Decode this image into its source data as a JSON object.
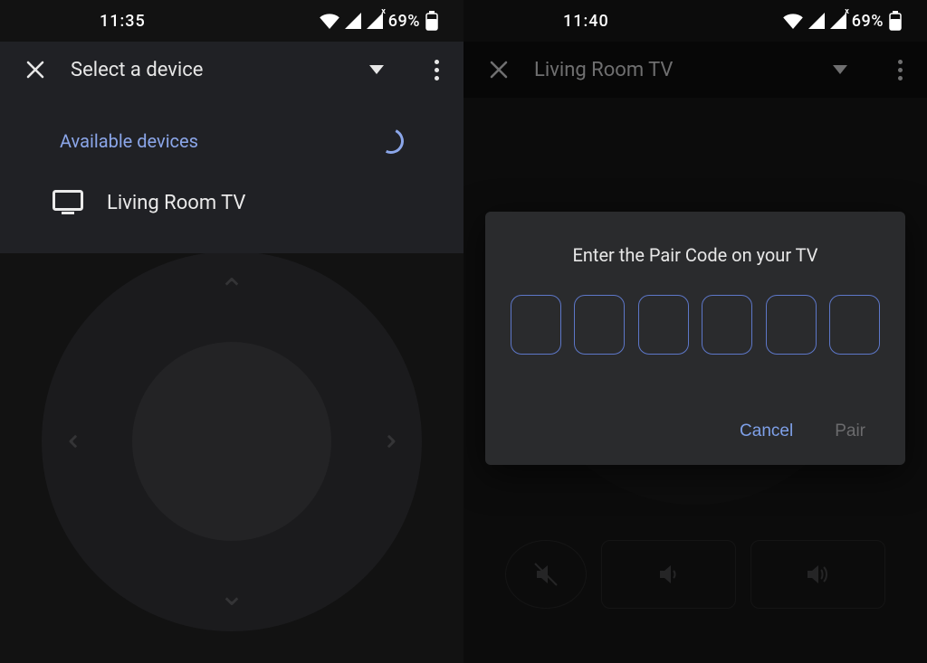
{
  "left": {
    "status": {
      "time": "11:35",
      "battery": "69%"
    },
    "appbar": {
      "title": "Select a device"
    },
    "panel": {
      "available_label": "Available devices",
      "devices": [
        {
          "name": "Living Room TV"
        }
      ]
    }
  },
  "right": {
    "status": {
      "time": "11:40",
      "battery": "69%"
    },
    "appbar": {
      "title": "Living Room TV"
    },
    "dialog": {
      "title": "Enter the Pair Code on your TV",
      "code_length": 6,
      "cancel": "Cancel",
      "pair": "Pair"
    }
  }
}
